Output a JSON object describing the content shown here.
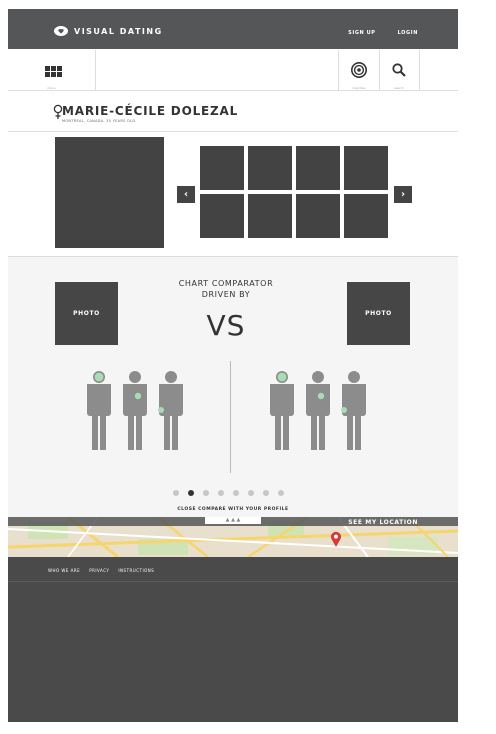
{
  "header": {
    "brand": "VISUAL DATING",
    "signup_label": "SIGN UP",
    "login_label": "LOGIN"
  },
  "iconbar": {
    "menu_sub": "menu",
    "target_sub": "matches",
    "search_sub": "search"
  },
  "profile": {
    "name": "MARIE-CÉCILE DOLEZAL",
    "meta": "MONTREAL, CANADA, 35 YEARS OLD"
  },
  "gallery": {
    "prev_label": "‹",
    "next_label": "›"
  },
  "comparator": {
    "title_line1": "CHART COMPARATOR",
    "title_line2": "DRIVEN BY",
    "vs_label": "VS",
    "left_photo_label": "PHOTO",
    "right_photo_label": "PHOTO",
    "close_label": "CLOSE COMPARE WITH YOUR PROFILE",
    "active_dot": 1
  },
  "map": {
    "toggle_label": "▲ ▲ ▲",
    "see_location_label": "SEE MY LOCATION"
  },
  "footer": {
    "links": [
      "WHO WE ARE",
      "PRIVACY",
      "INSTRUCTIONS"
    ]
  },
  "colors": {
    "dark": "#444444",
    "accent_green": "#a8dcb5",
    "pin_red": "#d33b3b"
  }
}
